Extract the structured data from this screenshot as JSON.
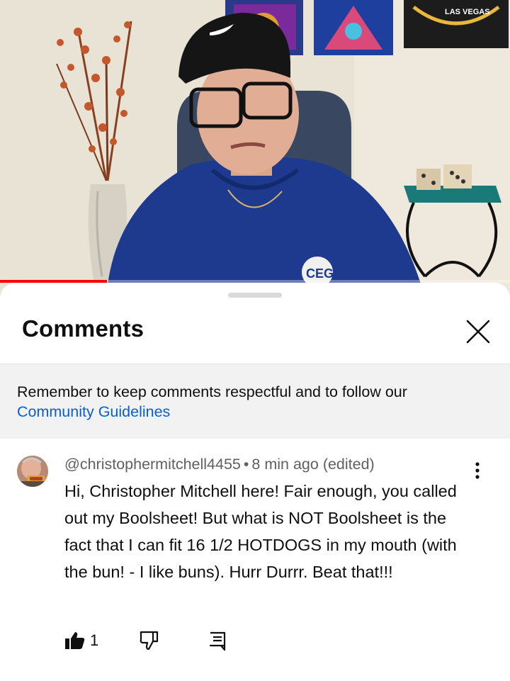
{
  "video": {
    "poster_top_right_text": "LAS VEGAS",
    "progress_fraction": 0.21
  },
  "comments_panel": {
    "title": "Comments",
    "close_label": "Close",
    "guidelines_text": "Remember to keep comments respectful and to follow our",
    "guidelines_link": "Community Guidelines"
  },
  "comment": {
    "author": "@christophermitchell4455",
    "separator": "•",
    "time": "8 min ago (edited)",
    "text": "Hi, Christopher Mitchell here! Fair enough, you called out my Boolsheet! But what is NOT Boolsheet is the fact that I can fit 16 1/2 HOTDOGS in my mouth (with the bun! - I like buns). Hurr Durrr. Beat that!!!",
    "like_count": "1"
  },
  "icons": {
    "close": "close-icon",
    "more": "more-vert-icon",
    "like": "thumbs-up-icon",
    "dislike": "thumbs-down-icon",
    "reply": "reply-icon"
  },
  "colors": {
    "link": "#065fd4",
    "progress": "#ff0000",
    "guidelines_bg": "#f2f2f2"
  }
}
